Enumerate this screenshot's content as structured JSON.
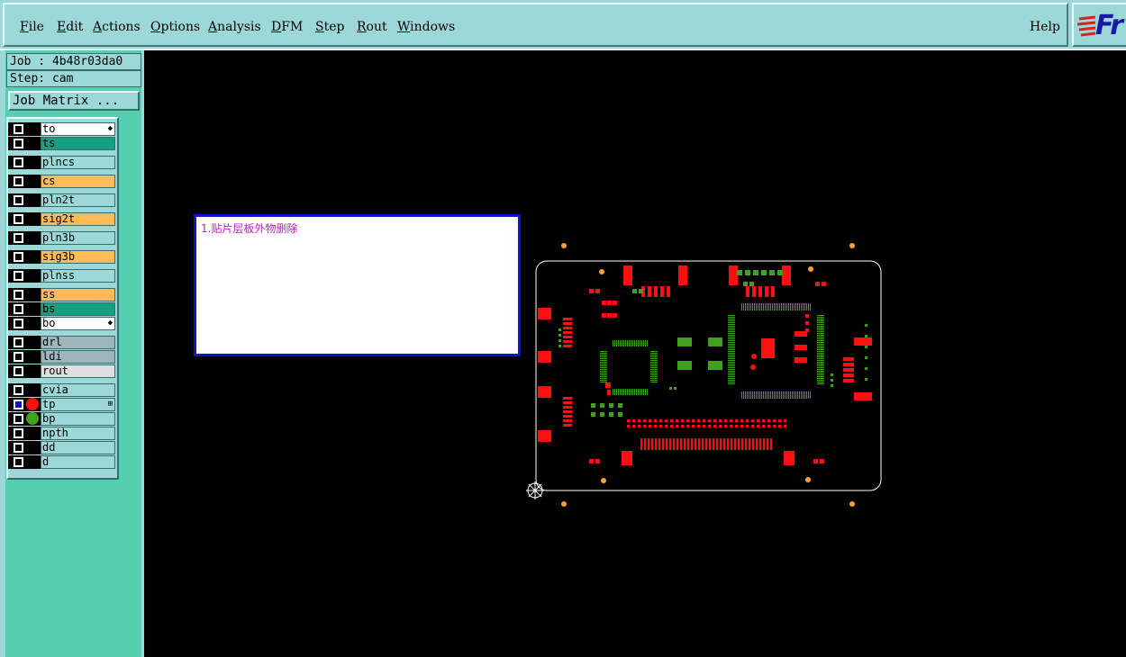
{
  "menu": {
    "items": [
      {
        "id": "file",
        "mn": "F",
        "rest": "ile"
      },
      {
        "id": "edit",
        "mn": "E",
        "rest": "dit"
      },
      {
        "id": "actions",
        "mn": "A",
        "rest": "ctions"
      },
      {
        "id": "options",
        "mn": "O",
        "rest": "ptions"
      },
      {
        "id": "analysis",
        "mn": "A",
        "rest": "nalysis"
      },
      {
        "id": "dfm",
        "mn": "D",
        "rest": "FM"
      },
      {
        "id": "step",
        "mn": "S",
        "rest": "tep"
      },
      {
        "id": "rout",
        "mn": "R",
        "rest": "out"
      },
      {
        "id": "windows",
        "mn": "W",
        "rest": "indows"
      }
    ],
    "help": "Help",
    "logo_text": "Fr"
  },
  "job": {
    "job_line": "Job : 4b48r03da0",
    "step_line": "Step: cam",
    "matrix_button": "Job Matrix ..."
  },
  "layers": [
    {
      "name": "to",
      "color": "#ffffff",
      "mark": "◆"
    },
    {
      "name": "ts",
      "color": "#14a080"
    },
    {
      "name": "plncs",
      "color": "#9cd8d8"
    },
    {
      "name": "cs",
      "color": "#ffbb55"
    },
    {
      "name": "pln2t",
      "color": "#9cd8d8"
    },
    {
      "name": "sig2t",
      "color": "#ffbb55"
    },
    {
      "name": "pln3b",
      "color": "#9cd8d8"
    },
    {
      "name": "sig3b",
      "color": "#ffbb55"
    },
    {
      "name": "plnss",
      "color": "#9cd8d8"
    },
    {
      "name": "ss",
      "color": "#ffbb55"
    },
    {
      "name": "bs",
      "color": "#14a080"
    },
    {
      "name": "bo",
      "color": "#ffffff",
      "mark": "◆"
    },
    {
      "name": "drl",
      "color": "#9db5bb"
    },
    {
      "name": "ldi",
      "color": "#9db5bb"
    },
    {
      "name": "rout",
      "color": "#dde0e0"
    },
    {
      "name": "cvia",
      "color": "#9cd8d8"
    },
    {
      "name": "tp",
      "color": "#9cd8d8",
      "active": true,
      "dot": "#ff1010",
      "mark": "⊞"
    },
    {
      "name": "bp",
      "color": "#9cd8d8",
      "dot": "#40a020"
    },
    {
      "name": "npth",
      "color": "#9cd8d8"
    },
    {
      "name": "dd",
      "color": "#9cd8d8"
    },
    {
      "name": "d",
      "color": "#9cd8d8"
    }
  ],
  "note": {
    "text": "1.贴片层板外物删除"
  },
  "pcb": {
    "colors": {
      "pad": "#ff1010",
      "bottom_pad": "#40a020",
      "fiducial": "#ffa030",
      "outline": "#ffffff"
    }
  }
}
